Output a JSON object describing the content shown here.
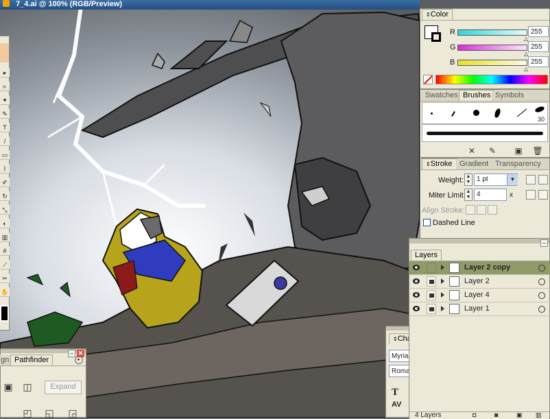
{
  "document": {
    "title": "7_4.ai @ 100% (RGB/Preview)"
  },
  "color_panel": {
    "tab_label": "Color",
    "channels": [
      {
        "name": "R",
        "value": "255",
        "color": "#2fd6dc"
      },
      {
        "name": "G",
        "value": "255",
        "color": "#d82fd8"
      },
      {
        "name": "B",
        "value": "255",
        "color": "#e8e02a"
      }
    ]
  },
  "swatches_panel": {
    "tabs": [
      "Swatches",
      "Brushes",
      "Symbols"
    ],
    "active_tab": "Brushes",
    "brush_size_label": "30"
  },
  "stroke_panel": {
    "tabs": [
      "Stroke",
      "Gradient",
      "Transparency"
    ],
    "weight_label": "Weight:",
    "weight_value": "1 pt",
    "miter_label": "Miter Limit:",
    "miter_value": "4",
    "miter_unit": "x",
    "align_label": "Align Stroke:",
    "dashed_label": "Dashed Line"
  },
  "layers_panel": {
    "tab_label": "Layers",
    "footer": "4 Layers",
    "layers": [
      {
        "name": "Layer 2 copy",
        "selected": true
      },
      {
        "name": "Layer 2",
        "selected": false
      },
      {
        "name": "Layer 4",
        "selected": false
      },
      {
        "name": "Layer 1",
        "selected": false
      }
    ]
  },
  "pathfinder_panel": {
    "tabs": [
      "gn",
      "Pathfinder"
    ],
    "expand_label": "Expand"
  },
  "character_panel": {
    "tab_label": "Cha",
    "font_family": "Myria",
    "font_style": "Roma"
  },
  "colors": {
    "ui_bg": "#ece9d8",
    "layer_selected": "#8f9c6a",
    "titlebar": "#2a5a8f"
  }
}
